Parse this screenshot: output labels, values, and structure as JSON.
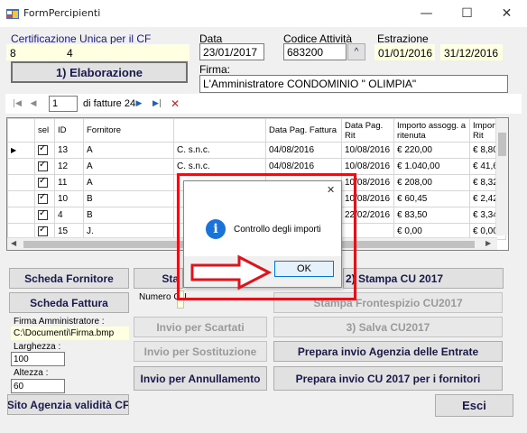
{
  "window": {
    "title": "FormPercipienti",
    "minimize": "—",
    "maximize": "☐",
    "close": "✕"
  },
  "cu": {
    "label": "Certificazione Unica per il CF",
    "val1": "8",
    "val2": "4"
  },
  "data_field": {
    "label": "Data",
    "value": "23/01/2017"
  },
  "codice": {
    "label": "Codice Attività",
    "value": "683200",
    "spin": "^"
  },
  "estrazione": {
    "label": "Estrazione",
    "from": "01/01/2016",
    "to": "31/12/2016"
  },
  "elaborazione_btn": "1) Elaborazione",
  "firma": {
    "label": "Firma:",
    "value": "L'Amministratore CONDOMINIO \" OLIMPIA\""
  },
  "navigator": {
    "first": "|◀",
    "prev": "◀",
    "position": "1",
    "count": "di fatture 24",
    "next": "▶",
    "last": "▶|",
    "delete": "✕"
  },
  "grid": {
    "headers": [
      "",
      "sel",
      "ID",
      "Fornitore",
      "",
      "Data Pag. Fattura",
      "Data Pag. Rit",
      "Importo assogg. a ritenuta",
      "Import Rit"
    ],
    "rows": [
      {
        "marker": "▶",
        "id": "13",
        "fornitore": "A",
        "nome": "C. s.n.c.",
        "data_fatt": "04/08/2016",
        "data_rit": "10/08/2016",
        "importo": "€ 220,00",
        "rit": "€ 8,80"
      },
      {
        "marker": "",
        "id": "12",
        "fornitore": "A",
        "nome": "C. s.n.c.",
        "data_fatt": "04/08/2016",
        "data_rit": "10/08/2016",
        "importo": "€ 1.040,00",
        "rit": "€ 41,60"
      },
      {
        "marker": "",
        "id": "11",
        "fornitore": "A",
        "nome": "",
        "data_fatt": "",
        "data_rit": "10/08/2016",
        "importo": "€ 208,00",
        "rit": "€ 8,32"
      },
      {
        "marker": "",
        "id": "10",
        "fornitore": "B",
        "nome": "",
        "data_fatt": "",
        "data_rit": "10/08/2016",
        "importo": "€ 60,45",
        "rit": "€ 2,42"
      },
      {
        "marker": "",
        "id": "4",
        "fornitore": "B",
        "nome": "",
        "data_fatt": "",
        "data_rit": "22/02/2016",
        "importo": "€ 83,50",
        "rit": "€ 3,34"
      },
      {
        "marker": "",
        "id": "15",
        "fornitore": "J.",
        "nome": "",
        "data_fatt": "",
        "data_rit": "",
        "importo": "€ 0,00",
        "rit": "€ 0,00"
      }
    ]
  },
  "buttons": {
    "scheda_fornitore": "Scheda Fornitore",
    "sta": "Sta",
    "stampa_cu": "2) Stampa CU 2017",
    "scheda_fattura": "Scheda Fattura",
    "numero_label": "Numero CU",
    "stampa_frontespizio": "Stampa Frontespizio CU2017",
    "invio_scartati": "Invio per Scartati",
    "salva_cu": "3) Salva CU2017",
    "invio_sostituzione": "Invio per Sostituzione",
    "prepara_agenzia": "Prepara  invio Agenzia delle Entrate",
    "invio_annullamento": "Invio per Annullamento",
    "prepara_fornitori": "Prepara invio CU 2017 per i fornitori",
    "sito_agenzia": "Sito Agenzia validità CF",
    "esci": "Esci"
  },
  "firma_amm": {
    "label": "Firma Amministratore :",
    "value": "C:\\Documenti\\Firma.bmp"
  },
  "larghezza": {
    "label": "Larghezza :",
    "value": "100"
  },
  "altezza": {
    "label": "Altezza :",
    "value": "60"
  },
  "dialog": {
    "message": "Controllo degli importi",
    "ok": "OK",
    "close": "✕",
    "icon": "i"
  },
  "colors": {
    "highlight_frame": "#e0131b",
    "info_icon": "#1a73d9",
    "field_highlight": "#ffffe1"
  }
}
